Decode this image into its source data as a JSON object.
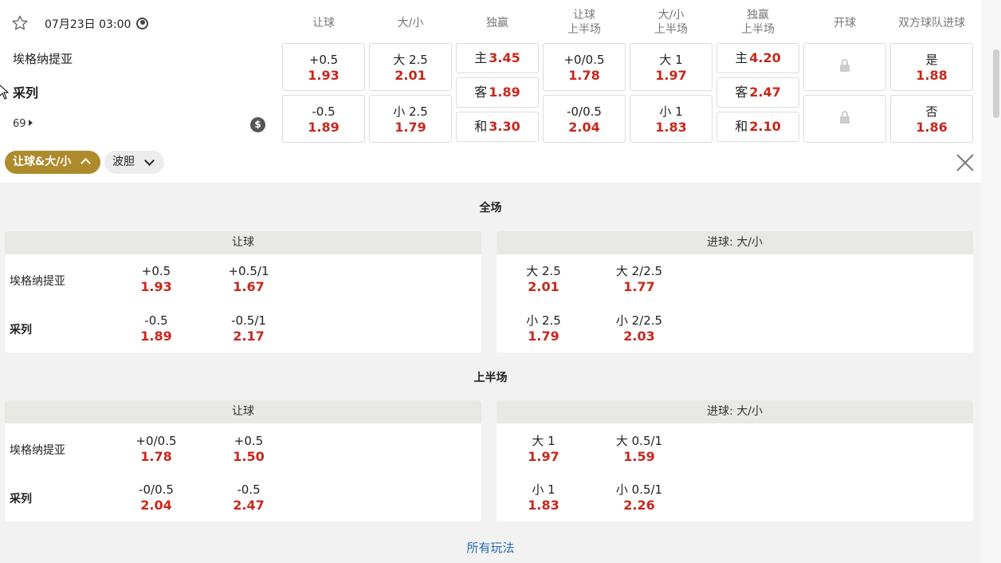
{
  "match": {
    "datetime": "07月23日 03:00",
    "team_a": "埃格纳提亚",
    "team_b": "采列",
    "more_count": "69"
  },
  "columns": [
    "让球",
    "大/小",
    "独赢",
    "让球\n上半场",
    "大/小\n上半场",
    "独赢\n上半场",
    "开球",
    "双方球队进球"
  ],
  "odds": {
    "hdp": [
      {
        "label": "+0.5",
        "odd": "1.93"
      },
      {
        "label": "-0.5",
        "odd": "1.89"
      }
    ],
    "ou": [
      {
        "label": "大 2.5",
        "odd": "2.01"
      },
      {
        "label": "小 2.5",
        "odd": "1.79"
      }
    ],
    "ml": [
      {
        "label": "主",
        "odd": "3.45"
      },
      {
        "label": "客",
        "odd": "1.89"
      },
      {
        "label": "和",
        "odd": "3.30"
      }
    ],
    "hdp_1h": [
      {
        "label": "+0/0.5",
        "odd": "1.78"
      },
      {
        "label": "-0/0.5",
        "odd": "2.04"
      }
    ],
    "ou_1h": [
      {
        "label": "大 1",
        "odd": "1.97"
      },
      {
        "label": "小 1",
        "odd": "1.83"
      }
    ],
    "ml_1h": [
      {
        "label": "主",
        "odd": "4.20"
      },
      {
        "label": "客",
        "odd": "2.47"
      },
      {
        "label": "和",
        "odd": "2.10"
      }
    ],
    "btts": [
      {
        "label": "是",
        "odd": "1.88"
      },
      {
        "label": "否",
        "odd": "1.86"
      }
    ]
  },
  "filters": {
    "active": "让球&大/小",
    "other": "波胆"
  },
  "full": {
    "title": "全场",
    "hdp_header": "让球",
    "ou_header": "进球: 大/小",
    "hdp_rows": [
      [
        {
          "label": "+0.5",
          "odd": "1.93"
        },
        {
          "label": "+0.5/1",
          "odd": "1.67"
        }
      ],
      [
        {
          "label": "-0.5",
          "odd": "1.89"
        },
        {
          "label": "-0.5/1",
          "odd": "2.17"
        }
      ]
    ],
    "ou_rows": [
      [
        {
          "label": "大 2.5",
          "odd": "2.01"
        },
        {
          "label": "大 2/2.5",
          "odd": "1.77"
        }
      ],
      [
        {
          "label": "小 2.5",
          "odd": "1.79"
        },
        {
          "label": "小 2/2.5",
          "odd": "2.03"
        }
      ]
    ]
  },
  "half": {
    "title": "上半场",
    "hdp_header": "让球",
    "ou_header": "进球: 大/小",
    "hdp_rows": [
      [
        {
          "label": "+0/0.5",
          "odd": "1.78"
        },
        {
          "label": "+0.5",
          "odd": "1.50"
        }
      ],
      [
        {
          "label": "-0/0.5",
          "odd": "2.04"
        },
        {
          "label": "-0.5",
          "odd": "2.47"
        }
      ]
    ],
    "ou_rows": [
      [
        {
          "label": "大 1",
          "odd": "1.97"
        },
        {
          "label": "大 0.5/1",
          "odd": "1.59"
        }
      ],
      [
        {
          "label": "小 1",
          "odd": "1.83"
        },
        {
          "label": "小 0.5/1",
          "odd": "2.26"
        }
      ]
    ]
  },
  "all_markets_link": "所有玩法",
  "colors": {
    "odd": "#c7281c",
    "accent": "#ad8a2b",
    "link": "#2a6bb7"
  }
}
